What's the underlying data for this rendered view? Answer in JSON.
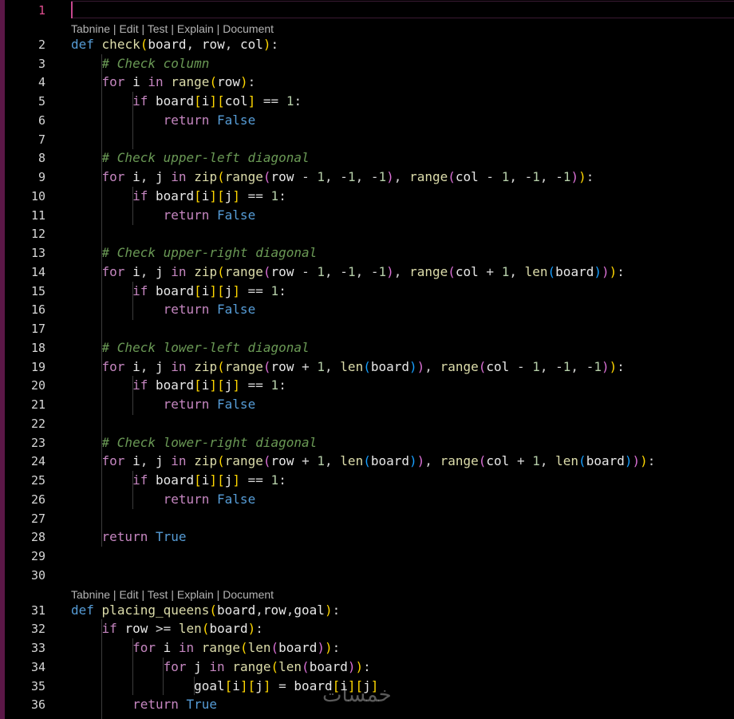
{
  "codelens": {
    "tabnine": "Tabnine",
    "edit": "Edit",
    "test": "Test",
    "explain": "Explain",
    "document": "Document",
    "separator": " | "
  },
  "active_line": 1,
  "line_numbers": [
    "1",
    "2",
    "3",
    "4",
    "5",
    "6",
    "7",
    "8",
    "9",
    "10",
    "11",
    "12",
    "13",
    "14",
    "15",
    "16",
    "17",
    "18",
    "19",
    "20",
    "21",
    "22",
    "23",
    "24",
    "25",
    "26",
    "27",
    "28",
    "29",
    "30",
    "31",
    "32",
    "33",
    "34",
    "35",
    "36"
  ],
  "code_lines": [
    "",
    "def check(board, row, col):",
    "    # Check column",
    "    for i in range(row):",
    "        if board[i][col] == 1:",
    "            return False",
    "",
    "    # Check upper-left diagonal",
    "    for i, j in zip(range(row - 1, -1, -1), range(col - 1, -1, -1)):",
    "        if board[i][j] == 1:",
    "            return False",
    "",
    "    # Check upper-right diagonal",
    "    for i, j in zip(range(row - 1, -1, -1), range(col + 1, len(board))):",
    "        if board[i][j] == 1:",
    "            return False",
    "",
    "    # Check lower-left diagonal",
    "    for i, j in zip(range(row + 1, len(board)), range(col - 1, -1, -1)):",
    "        if board[i][j] == 1:",
    "            return False",
    "",
    "    # Check lower-right diagonal",
    "    for i, j in zip(range(row + 1, len(board)), range(col + 1, len(board))):",
    "        if board[i][j] == 1:",
    "            return False",
    "",
    "    return True",
    "",
    "",
    "def placing_queens(board,row,goal):",
    "    if row >= len(board):",
    "        for i in range(len(board)):",
    "            for j in range(len(board)):",
    "                goal[i][j] = board[i][j]",
    "        return True"
  ],
  "watermark": "خمسات",
  "colors": {
    "background": "#000000",
    "keyword": "#c586c0",
    "builtin_const": "#569cd6",
    "function": "#dcdcaa",
    "number": "#b5cea8",
    "comment": "#6a9955",
    "active_line_number": "#e04e8f"
  }
}
